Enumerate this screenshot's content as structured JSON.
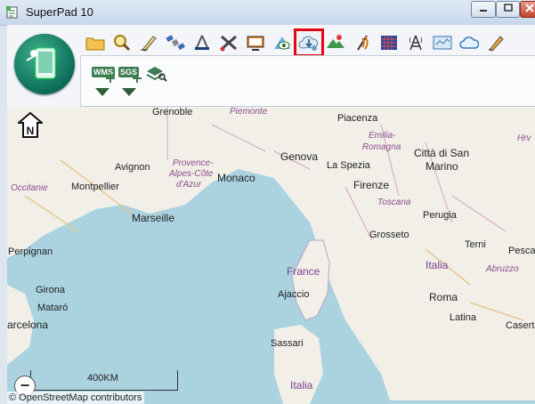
{
  "window": {
    "title": "SuperPad 10"
  },
  "toolbar": {
    "tools": [
      "folder-icon",
      "magnify-icon",
      "pencil-measure-icon",
      "satellite-icon",
      "survey-icon",
      "wrench-scissors-icon",
      "monitor-icon",
      "layer-view-icon",
      "cloud-download-icon",
      "landscape-icon",
      "signal-icon",
      "grid-icon",
      "tower-icon",
      "map-pin-icon",
      "cloud-icon",
      "pen-icon"
    ],
    "selected_tool": "cloud-download-icon"
  },
  "subtools": {
    "wms": "WMS",
    "sgs": "SGS"
  },
  "map": {
    "places": {
      "grenoble": "Grenoble",
      "piemonte": "Piemonte",
      "piacenza": "Piacenza",
      "emilia": "Emilia-",
      "romagna": "Romagna",
      "genova": "Genova",
      "citta": "Città di San",
      "marino": "Marino",
      "provence1": "Provence-",
      "provence2": "Alpes-Côte",
      "provence3": "d'Azur",
      "avignon": "Avignon",
      "montpellier": "Montpellier",
      "occitanie": "Occitanie",
      "monaco": "Monaco",
      "laspezia": "La Spezia",
      "firenze": "Firenze",
      "toscana": "Toscana",
      "perugia": "Perugia",
      "marseille": "Marseille",
      "perpignan": "Perpignan",
      "grosseto": "Grosseto",
      "terni": "Terni",
      "pescara": "Pescara",
      "italia": "Italia",
      "abruzzo": "Abruzzo",
      "girona": "Girona",
      "france": "France",
      "ajaccio": "Ajaccio",
      "roma": "Roma",
      "mataro": "Mataró",
      "latina": "Latina",
      "barcelona": "arcelona",
      "caserta": "Caserta",
      "sassari": "Sassari",
      "italia2": "Italia",
      "hrv": "Hrv"
    },
    "scale_label": "400KM",
    "attribution": "© OpenStreetMap contributors",
    "north_label": "N"
  },
  "colors": {
    "highlight": "#e30613",
    "sea": "#aad3df",
    "land": "#f2efe9"
  }
}
